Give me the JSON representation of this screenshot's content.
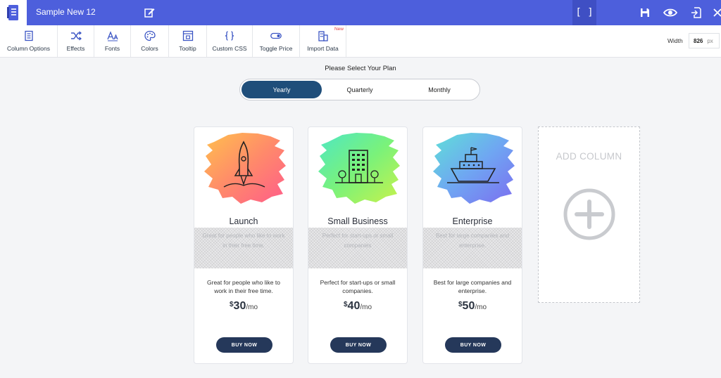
{
  "header": {
    "title": "Sample New 12",
    "logo_icon": "document-icon",
    "brackets": "[ ]",
    "icons": [
      "edit-icon",
      "save-icon",
      "eye-icon",
      "export-icon",
      "close-icon"
    ]
  },
  "toolbar": {
    "items": [
      {
        "label": "Column Options",
        "icon": "column-options-icon"
      },
      {
        "label": "Effects",
        "icon": "shuffle-icon"
      },
      {
        "label": "Fonts",
        "icon": "font-icon"
      },
      {
        "label": "Colors",
        "icon": "palette-icon"
      },
      {
        "label": "Tooltip",
        "icon": "tooltip-icon"
      },
      {
        "label": "Custom CSS",
        "icon": "braces-icon"
      },
      {
        "label": "Toggle Price",
        "icon": "toggle-icon"
      },
      {
        "label": "Import Data",
        "icon": "import-icon",
        "badge": "New"
      }
    ],
    "width_label": "Width",
    "width_value": "826",
    "width_unit": "px"
  },
  "plan_selector": {
    "title": "Please Select Your Plan",
    "options": [
      "Yearly",
      "Quarterly",
      "Monthly"
    ],
    "active": "Yearly"
  },
  "cards": [
    {
      "name": "Launch",
      "tagline": "Great for people who like to work in their free time.",
      "description": "Great for people who like to work in their free time.",
      "currency": "$",
      "amount": "30",
      "period": "/mo",
      "button": "BUY NOW",
      "icon": "rocket-icon"
    },
    {
      "name": "Small Business",
      "tagline": "Perfect for start-ups or small companies",
      "description": "Perfect for start-ups or small companies.",
      "currency": "$",
      "amount": "40",
      "period": "/mo",
      "button": "BUY NOW",
      "icon": "building-icon"
    },
    {
      "name": "Enterprise",
      "tagline": "Best for large companies and enterprise.",
      "description": "Best for large companies and enterprise.",
      "currency": "$",
      "amount": "50",
      "period": "/mo",
      "button": "BUY NOW",
      "icon": "ship-icon"
    }
  ],
  "add_column": {
    "label": "ADD COLUMN",
    "icon": "plus-circle-icon"
  },
  "colors": {
    "header_bg": "#4d5fdc",
    "toggle_active": "#1f4e7a",
    "button_bg": "#25385a"
  }
}
